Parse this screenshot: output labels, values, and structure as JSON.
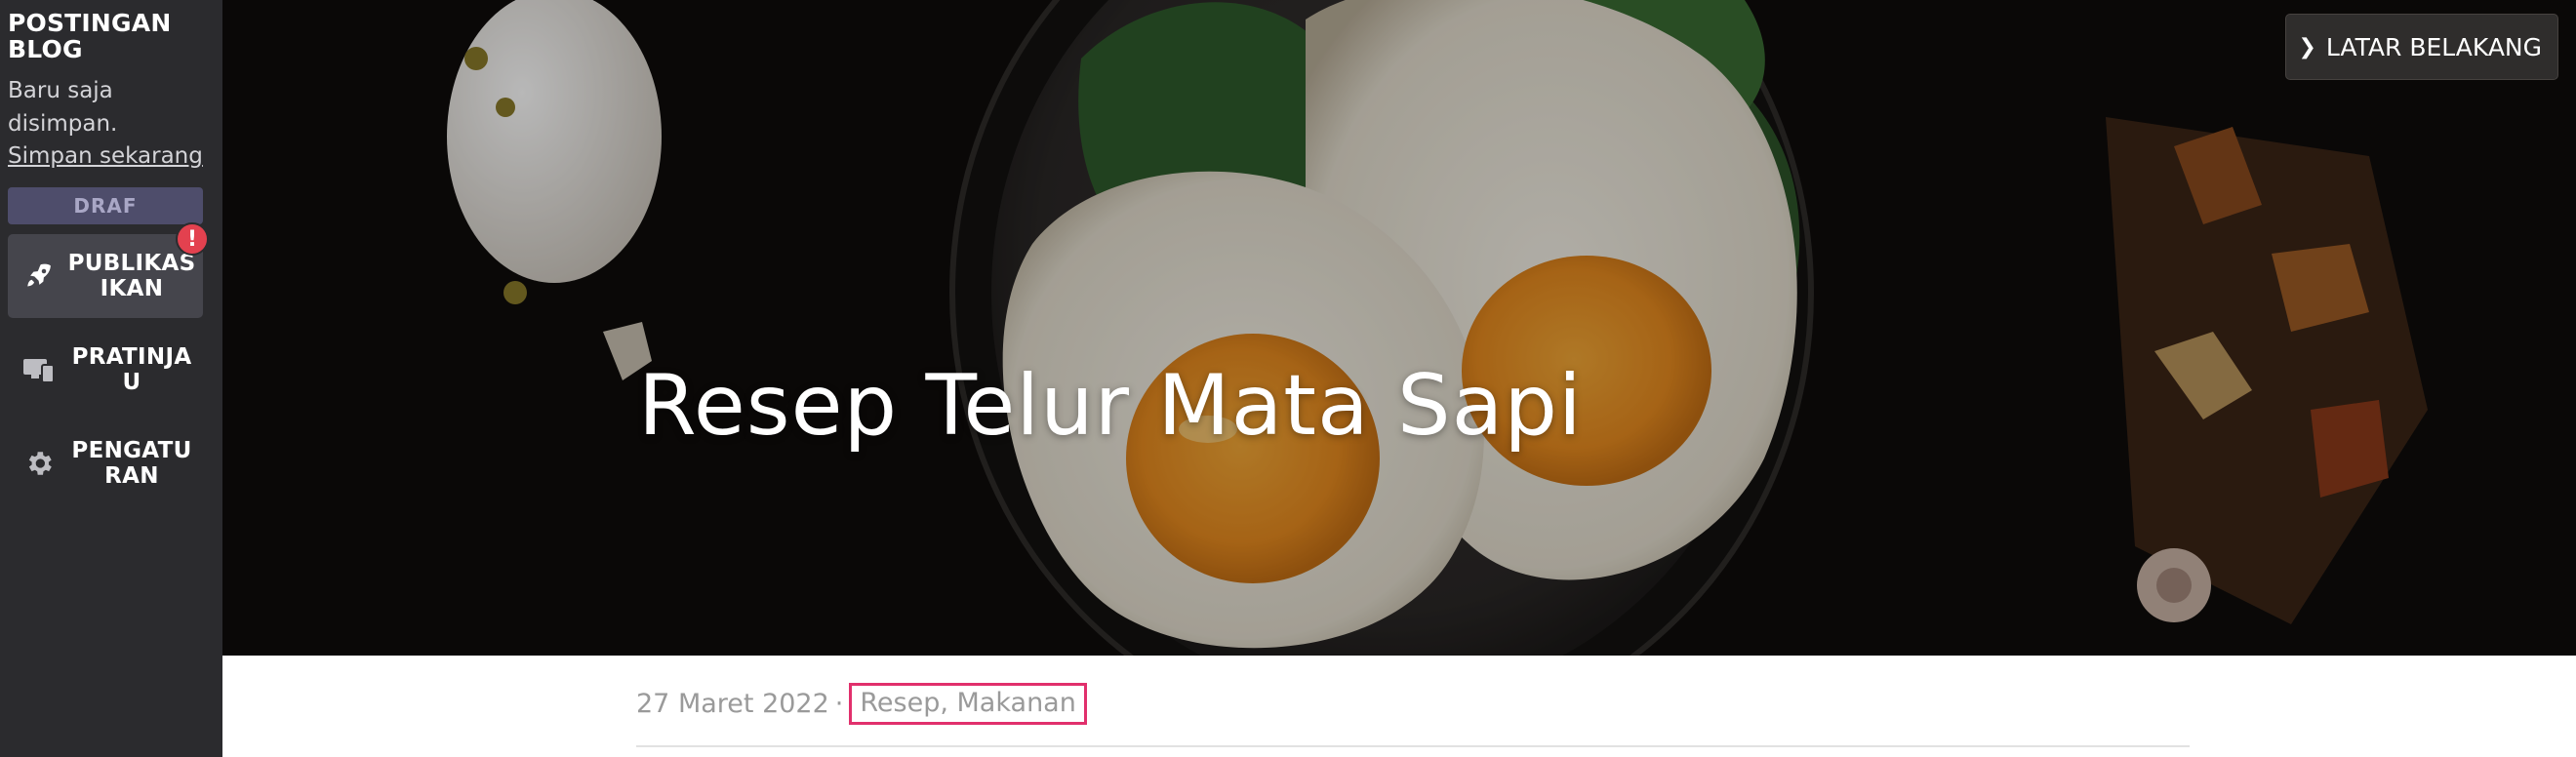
{
  "sidebar": {
    "post_type": "POSTINGAN BLOG",
    "save_status": "Baru saja disimpan.",
    "save_now_link": "Simpan sekarang",
    "draft_badge": "DRAF",
    "publish": {
      "label": "PUBLIKASIKAN",
      "alert": "!"
    },
    "preview": {
      "label": "PRATINJAU"
    },
    "settings": {
      "label": "PENGATURAN"
    }
  },
  "hero": {
    "title": "Resep Telur Mata Sapi",
    "background_button": "LATAR BELAKANG",
    "background_button_icon": "chevron-right-icon"
  },
  "meta": {
    "date": "27 Maret 2022",
    "separator": "·",
    "categories": "Resep, Makanan"
  },
  "colors": {
    "sidebar_bg": "#2b2b2e",
    "publish_bg": "#45454c",
    "draft_bg": "#4e4d6b",
    "alert": "#e3414f",
    "highlight": "#e1306c"
  }
}
